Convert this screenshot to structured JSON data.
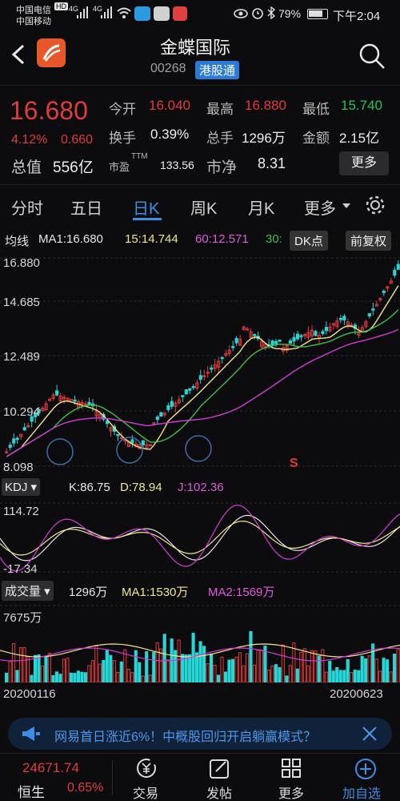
{
  "status": {
    "carrier1": "中国电信",
    "carrier2": "中国移动",
    "hd": "HD",
    "net1": "4G",
    "net2": "4G",
    "battery": "79%",
    "time": "下午2:04"
  },
  "header": {
    "name": "金蝶国际",
    "code": "00268",
    "tag": "港股通"
  },
  "quote": {
    "price": "16.680",
    "change_pct": "4.12%",
    "change_amt": "0.660",
    "open_label": "今开",
    "open": "16.040",
    "high_label": "最高",
    "high": "16.880",
    "low_label": "最低",
    "low": "15.740",
    "turnover_label": "换手",
    "turnover": "0.39%",
    "volume_label": "总手",
    "volume": "1296万",
    "amount_label": "金额",
    "amount": "2.15亿",
    "mktcap_label": "总值",
    "mktcap": "556亿",
    "pe_label": "市盈",
    "pe_sup": "TTM",
    "pe": "133.56",
    "pb_label": "市净",
    "pb": "8.31",
    "more_label": "更多"
  },
  "tabs": [
    "分时",
    "五日",
    "日K",
    "周K",
    "月K",
    "更多"
  ],
  "active_tab": 2,
  "main_chart": {
    "ma_label": "均线",
    "ma1": "MA1:16.680",
    "ma15": "15:14.744",
    "ma60": "60:12.571",
    "ma30": "30:",
    "dk_label": "DK点",
    "fq_label": "前复权",
    "y_labels": [
      "16.880",
      "14.685",
      "12.489",
      "10.294",
      "8.098"
    ],
    "signal": "S",
    "colors": {
      "up": "#e23b3b",
      "down": "#27d6d6",
      "ma1": "#f0e68c",
      "ma2": "#3cc04a",
      "ma3": "#d43ad4"
    }
  },
  "kdj": {
    "selector": "KDJ",
    "k": "K:86.75",
    "d": "D:78.94",
    "j": "J:102.36",
    "y_top": "114.72",
    "y_bottom": "-17.34"
  },
  "volume": {
    "selector": "成交量",
    "value": "1296万",
    "ma1": "MA1:1530万",
    "ma2": "MA2:1569万",
    "y_top": "7675万",
    "date_start": "20200116",
    "date_end": "20200623"
  },
  "news": {
    "text": "网易首日涨近6%！中概股回归开启躺赢模式？"
  },
  "bottom_nav": {
    "index_value": "24671.74",
    "index_name": "恒生",
    "index_change": "0.65%",
    "items": [
      "交易",
      "发帖",
      "更多",
      "加自选"
    ]
  }
}
